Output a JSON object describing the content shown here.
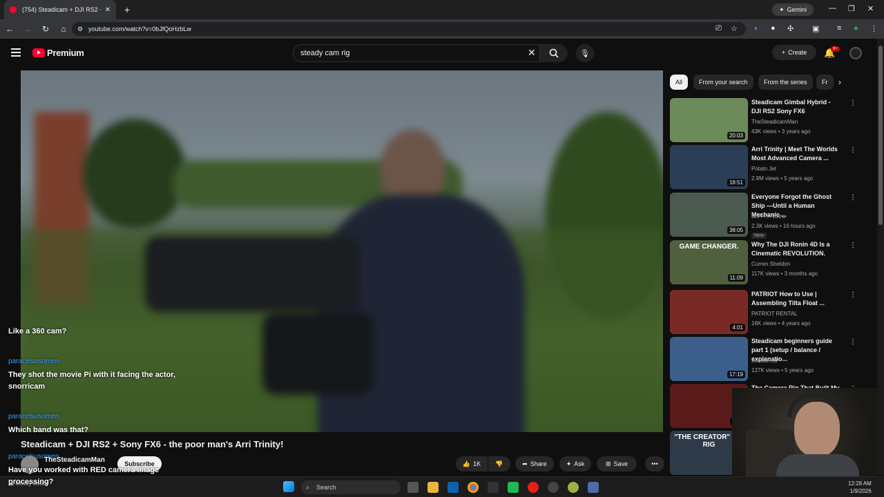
{
  "browser": {
    "tab_title": "(754) Steadicam + DJI RS2 + So",
    "tab_close": "✕",
    "new_tab": "+",
    "url": "youtube.com/watch?v=0bJfQoHzbLw",
    "gemini_label": "Gemini"
  },
  "header": {
    "logo_text": "Premium",
    "search_value": "steady cam rig",
    "create_label": "Create",
    "notif_count": "9+"
  },
  "chat": [
    {
      "name": "",
      "text": "Like a 360 cam?"
    },
    {
      "name": "paracelsusomen",
      "text": "They shot the movie Pi with it facing the actor, snorricam"
    },
    {
      "name": "paracelsusomen",
      "text": "Which band was that?"
    },
    {
      "name": "paracelsusomen",
      "text": "Have you worked with RED camera image processing?"
    }
  ],
  "video": {
    "title": "Steadicam + DJI RS2 + Sony FX6 - the poor man's Arri Trinity!",
    "channel": "TheSteadicamMan",
    "subscribe": "Subscribe",
    "likes": "1K",
    "share": "Share",
    "ask": "Ask",
    "save": "Save"
  },
  "chips": [
    "All",
    "From your search",
    "From the series",
    "Fr"
  ],
  "recommendations": [
    {
      "title": "Steadicam Gimbal Hybrid - DJI RS2 Sony FX6",
      "channel": "TheSteadicamMan",
      "meta": "43K views • 3 years ago",
      "duration": "20:03",
      "thumb": "#6d8a5a"
    },
    {
      "title": "Arri Trinity | Meet The Worlds Most Advanced Camera ...",
      "channel": "Potato Jet",
      "meta": "2.9M views • 5 years ago",
      "duration": "18:51",
      "thumb": "#2c3e56"
    },
    {
      "title": "Everyone Forgot the Ghost Ship —Until a Human Mechanic ...",
      "channel": "Sci-Fi X Extra",
      "meta": "2.3K views • 16 hours ago",
      "duration": "38:05",
      "thumb": "#4b5a4e",
      "badge": "New"
    },
    {
      "title": "Why The DJI Ronin 4D Is a Cinematic REVOLUTION.",
      "channel": "Curren Sheldon",
      "meta": "117K views • 3 months ago",
      "duration": "11:09",
      "thumb": "#50603f",
      "overlay": "GAME CHANGER."
    },
    {
      "title": "PATRIOT How to Use | Assembling Tilta Float ...",
      "channel": "PATRIOT RENTAL",
      "meta": "16K views • 4 years ago",
      "duration": "4:01",
      "thumb": "#7a2a26"
    },
    {
      "title": "Steadicam beginners guide part 1 (setup / balance / explanatio...",
      "channel": "SteadiRed",
      "meta": "127K views • 5 years ago",
      "duration": "17:19",
      "thumb": "#3b5f8a"
    },
    {
      "title": "The Camera Rig That Built My Career",
      "channel": "",
      "meta": "",
      "duration": "9:09",
      "thumb": "#5a1a1a"
    },
    {
      "title": "",
      "channel": "",
      "meta": "",
      "duration": "",
      "thumb": "#2e3a48",
      "overlay": "\"THE CREATOR\" DIY RIG"
    }
  ],
  "taskbar": {
    "weather": "Mostly cloudy",
    "search": "Search",
    "time": "12:28 AM",
    "date": "1/9/2026"
  }
}
